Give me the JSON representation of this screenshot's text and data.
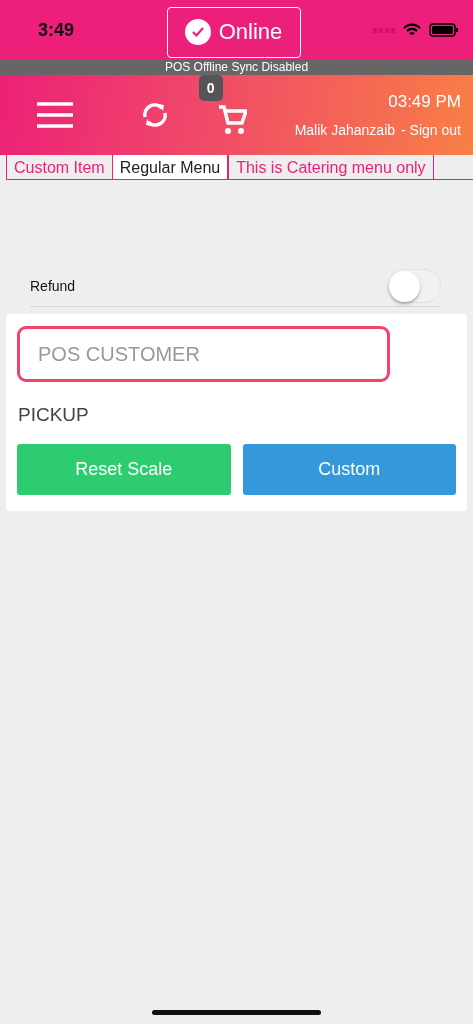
{
  "status_bar": {
    "time": "3:49"
  },
  "connection": {
    "label": "Online",
    "online": true
  },
  "sync_banner": "POS Offline Sync Disabled",
  "header": {
    "cart_count": "0",
    "clock": "03:49 PM",
    "user": "Malik Jahanzaib",
    "sign_out": "- Sign out"
  },
  "tabs": [
    {
      "label": "Custom Item",
      "selected": false
    },
    {
      "label": "Regular Menu",
      "selected": true
    },
    {
      "label": "This is Catering menu only",
      "selected": false
    }
  ],
  "refund": {
    "label": "Refund",
    "on": false
  },
  "customer_field": {
    "placeholder": "POS CUSTOMER"
  },
  "order_type": "PICKUP",
  "buttons": [
    {
      "label": "Reset Scale",
      "color": "#2ecc71"
    },
    {
      "label": "Custom",
      "color": "#3498db"
    }
  ]
}
